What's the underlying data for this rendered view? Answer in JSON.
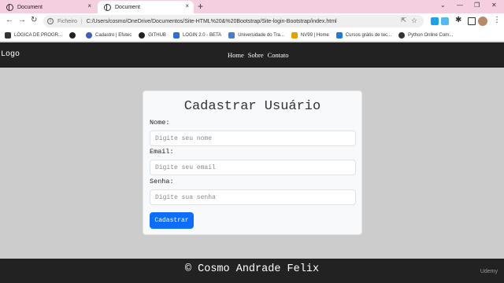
{
  "browser": {
    "tabs": [
      {
        "label": "Document"
      },
      {
        "label": "Document"
      }
    ],
    "new_tab_glyph": "+",
    "close_glyph": "×",
    "window_controls": {
      "down": "⌄",
      "minimize": "—",
      "restore": "❐",
      "close": "✕"
    },
    "nav": {
      "back": "←",
      "forward": "→",
      "reload": "↻"
    },
    "address": {
      "scheme_label": "Ficheiro",
      "separator": "|",
      "url": "C:/Users/cosmo/OneDrive/Documentos/Site-HTML%20&%20Bootstrap/Site-login-Bootstrap/index.html"
    },
    "bookmarks": [
      {
        "label": "LÓGICA DE PROGR...",
        "icon": "dark-square-icon",
        "color": "#333333"
      },
      {
        "label": "",
        "icon": "github-globe-icon",
        "color": "#222222"
      },
      {
        "label": "Cadastro | Efutec",
        "icon": "blue-circle-icon",
        "color": "#3b5fc0"
      },
      {
        "label": "GITHUB",
        "icon": "github-icon",
        "color": "#222222"
      },
      {
        "label": "LOGIN 2.0 - BETA",
        "icon": "grid-icon",
        "color": "#2d6fd6"
      },
      {
        "label": "Universidade do Tra...",
        "icon": "university-icon",
        "color": "#4a7bd0"
      },
      {
        "label": "NV99 | Home",
        "icon": "nv99-icon",
        "color": "#e8a000"
      },
      {
        "label": "Cursos grátis de tec...",
        "icon": "leaf-icon",
        "color": "#1f7ae0"
      },
      {
        "label": "Python Online Com...",
        "icon": "python-icon",
        "color": "#333333"
      }
    ]
  },
  "site": {
    "logo": "Logo",
    "nav_links": [
      "Home",
      "Sobre",
      "Contato"
    ],
    "form": {
      "title": "Cadastrar Usuário",
      "fields": [
        {
          "label": "Nome:",
          "placeholder": "Digite seu nome"
        },
        {
          "label": "Email:",
          "placeholder": "Digite seu email"
        },
        {
          "label": "Senha:",
          "placeholder": "Digite sua senha"
        }
      ],
      "submit_label": "Cadastrar"
    },
    "footer": "© Cosmo Andrade Felix"
  },
  "watermark": "Udemy",
  "colors": {
    "tabstrip": "#f4cfe0",
    "navbar": "#222222",
    "page_bg": "#cccccc",
    "primary_button": "#0d6efd"
  }
}
